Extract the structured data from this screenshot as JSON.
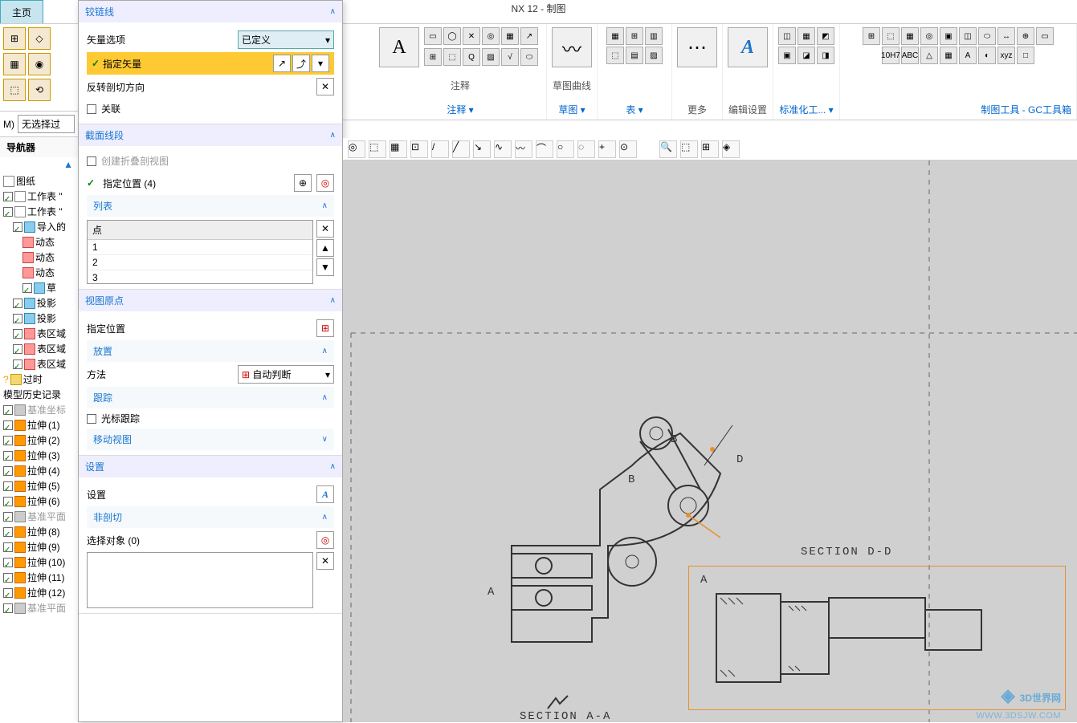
{
  "app_title": "NX 12 - 制图",
  "tabs": {
    "main": "主页"
  },
  "ribbon": {
    "note": {
      "label": "注释",
      "bigchar": "A"
    },
    "note_group": "注释",
    "sketch_curve": {
      "label": "草图曲线"
    },
    "sketch_group": "草图",
    "more": "更多",
    "table_group": "表",
    "edit_settings": "编辑设置",
    "std_tools": "标准化工...",
    "drafting_tools": "制图工具 - GC工具箱"
  },
  "filter": {
    "no_sel": "无选择过"
  },
  "navigator_title": "导航器",
  "tree": {
    "drawings": "图纸",
    "sheet1": "工作表 \"",
    "sheet2": "工作表 \"",
    "imported": "导入的",
    "dynamic": "动态",
    "sketch": "草",
    "proj": "投影",
    "region": "表区域",
    "outdated": "过时",
    "history": "模型历史记录",
    "datum_cs": "基准坐标",
    "extrude": "拉伸",
    "datum_plane": "基准平面"
  },
  "dialog": {
    "hinge_line": "铰链线",
    "vector_option": "矢量选项",
    "defined": "已定义",
    "specify_vector": "指定矢量",
    "reverse_cut": "反转剖切方向",
    "assoc": "关联",
    "section_seg": "截面线段",
    "create_fold": "创建折叠剖视图",
    "specify_pos": "指定位置 (4)",
    "list": "列表",
    "point": "点",
    "p1": "1",
    "p2": "2",
    "p3": "3",
    "view_origin": "视图原点",
    "specify_pos2": "指定位置",
    "place": "放置",
    "method": "方法",
    "auto_judge": "自动判断",
    "track": "跟踪",
    "cursor_track": "光标跟踪",
    "move_view": "移动视图",
    "settings": "设置",
    "non_cut": "非剖切",
    "select_obj": "选择对象 (0)"
  },
  "canvas": {
    "section_dd": "SECTION D-D",
    "section_aa": "SECTION A-A",
    "lbl_a": "A",
    "lbl_b": "B",
    "lbl_b2": "B",
    "lbl_d": "D",
    "lbl_a2": "A"
  },
  "watermark": "3D世界网",
  "watermark_sub": "WWW.3DSJW.COM"
}
